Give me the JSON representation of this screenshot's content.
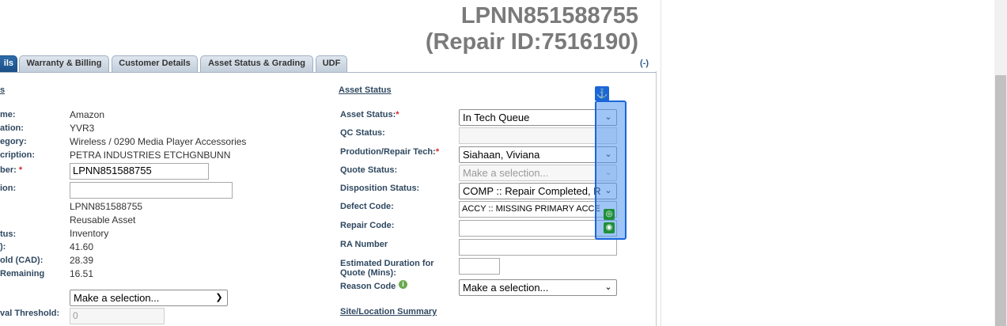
{
  "header": {
    "title_line1": "LPNN851588755",
    "title_line2": "(Repair ID:7516190)",
    "collapse": "(-)"
  },
  "tabs": [
    {
      "label": "ils",
      "active": true
    },
    {
      "label": "Warranty & Billing"
    },
    {
      "label": "Customer Details"
    },
    {
      "label": "Asset Status & Grading"
    },
    {
      "label": "UDF"
    }
  ],
  "left": {
    "section_fragment": "s",
    "rows": [
      {
        "label": "me:",
        "value": "Amazon"
      },
      {
        "label": "ation:",
        "value": "YVR3"
      },
      {
        "label": "egory:",
        "value": "Wireless / 0290 Media Player Accessories"
      },
      {
        "label": "cription:",
        "value": "PETRA INDUSTRIES ETCHGNBUNN"
      },
      {
        "label": "ber:",
        "required": "*",
        "input_value": "LPNN851588755"
      },
      {
        "label": "ion:",
        "input_value": ""
      },
      {
        "label": "",
        "value": "LPNN851588755"
      },
      {
        "label": "",
        "value": "Reusable Asset"
      },
      {
        "label": "tus:",
        "value": "Inventory"
      },
      {
        "label": "):",
        "value": "41.60"
      },
      {
        "label": "old (CAD):",
        "value": "28.39"
      },
      {
        "label": "Remaining",
        "value": "16.51"
      }
    ],
    "select_value": "Make a selection...",
    "threshold_label": "val Threshold:",
    "threshold_value": "0"
  },
  "asset_status": {
    "heading": "Asset Status",
    "fields": {
      "asset_status": {
        "label": "Asset Status:",
        "required": "*",
        "value": "In Tech Queue"
      },
      "qc_status": {
        "label": "QC Status:",
        "value": ""
      },
      "tech": {
        "label": "Prodution/Repair Tech:",
        "required": "*",
        "value": "Siahaan, Viviana"
      },
      "quote_status": {
        "label": "Quote Status:",
        "value": "Make a selection..."
      },
      "disposition": {
        "label": "Disposition Status:",
        "value": "COMP :: Repair Completed, R"
      },
      "defect_code": {
        "label": "Defect Code:",
        "value": "ACCY :: MISSING PRIMARY ACCE"
      },
      "repair_code": {
        "label": "Repair Code:",
        "value": ""
      },
      "ra_number": {
        "label": "RA Number",
        "value": ""
      },
      "est_duration": {
        "label_1": "Estimated Duration for",
        "label_2": "Quote (Mins):",
        "value": ""
      },
      "reason_code": {
        "label": "Reason Code",
        "value": "Make a selection..."
      }
    },
    "site_heading": "Site/Location Summary"
  },
  "icons": {
    "anchor": "anchor-icon",
    "info": "info-icon",
    "target": "target-icon",
    "camera": "camera-icon",
    "chevron": "chevron-down-icon"
  },
  "colors": {
    "active_tab": "#1b4f86",
    "overlay": "#1a66d8",
    "required": "#d9262c",
    "green_button": "#1f8f3a"
  }
}
